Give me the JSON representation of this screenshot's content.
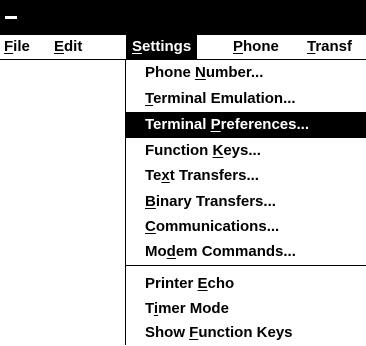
{
  "menubar": {
    "file": {
      "pre": "",
      "key": "F",
      "post": "ile"
    },
    "edit": {
      "pre": "",
      "key": "E",
      "post": "dit"
    },
    "settings": {
      "pre": "",
      "key": "S",
      "post": "ettings"
    },
    "phone": {
      "pre": "",
      "key": "P",
      "post": "hone"
    },
    "transfers": {
      "pre": "",
      "key": "T",
      "post": "ransf"
    }
  },
  "settings_menu": {
    "items": [
      {
        "pre": "Phone ",
        "key": "N",
        "post": "umber..."
      },
      {
        "pre": "",
        "key": "T",
        "post": "erminal Emulation..."
      },
      {
        "pre": "Terminal ",
        "key": "P",
        "post": "references..."
      },
      {
        "pre": "Function ",
        "key": "K",
        "post": "eys..."
      },
      {
        "pre": "Te",
        "key": "x",
        "post": "t Transfers..."
      },
      {
        "pre": "",
        "key": "B",
        "post": "inary Transfers..."
      },
      {
        "pre": "",
        "key": "C",
        "post": "ommunications..."
      },
      {
        "pre": "Mo",
        "key": "d",
        "post": "em Commands..."
      },
      {
        "pre": "Printer ",
        "key": "E",
        "post": "cho"
      },
      {
        "pre": "T",
        "key": "i",
        "post": "mer Mode"
      },
      {
        "pre": "Show ",
        "key": "F",
        "post": "unction Keys"
      }
    ],
    "highlighted_index": 2
  }
}
